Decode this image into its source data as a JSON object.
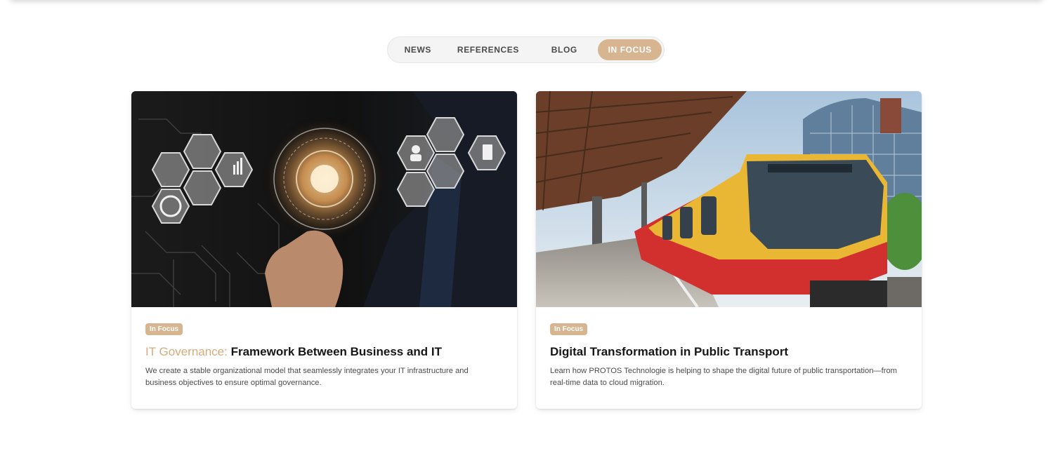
{
  "tabs": [
    {
      "label": "NEWS",
      "active": false
    },
    {
      "label": "REFERENCES",
      "active": false
    },
    {
      "label": "BLOG",
      "active": false
    },
    {
      "label": "IN FOCUS",
      "active": true
    }
  ],
  "colors": {
    "accent": "#d6b590",
    "accent_text": "#d4ac7d",
    "title": "#161616",
    "body_text": "#4b4b4b"
  },
  "cards": [
    {
      "badge": "In Focus",
      "title_accent": "IT Governance:",
      "title": " Framework Between Business and IT",
      "description": "We create a stable organizational model that seamlessly integrates your IT infrastructure and business objectives to ensure optimal governance.",
      "image_icon": "lightbulb-hexagon-network-image"
    },
    {
      "badge": "In Focus",
      "title_accent": "",
      "title": "Digital Transformation in Public Transport",
      "description": "Learn how PROTOS Technologie is helping to shape the digital future of public transportation—from real-time data to cloud migration.",
      "image_icon": "train-platform-image"
    }
  ]
}
